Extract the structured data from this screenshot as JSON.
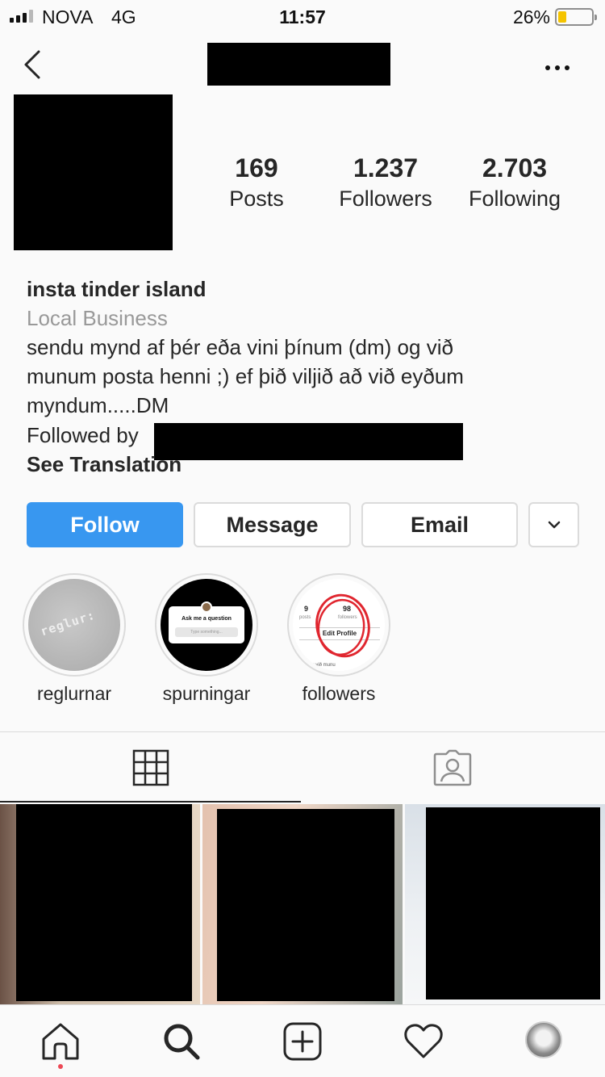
{
  "status_bar": {
    "carrier": "NOVA",
    "network": "4G",
    "time": "11:57",
    "battery_percent": "26%",
    "battery_level": 0.26,
    "signal_bars": 3
  },
  "header": {
    "back_icon": "chevron-left-icon",
    "more_icon": "more-horizontal-icon"
  },
  "stats": [
    {
      "value": "169",
      "label": "Posts"
    },
    {
      "value": "1.237",
      "label": "Followers"
    },
    {
      "value": "2.703",
      "label": "Following"
    }
  ],
  "bio": {
    "name": "insta tinder island",
    "category": "Local Business",
    "line1": "sendu mynd af þér eða vini þínum (dm) og við",
    "line2": "munum posta henni ;) ef þið viljið að við eyðum",
    "line3": "myndum.....DM",
    "followed_by": "Followed by",
    "see_translation": "See Translation"
  },
  "actions": {
    "follow": "Follow",
    "message": "Message",
    "email": "Email",
    "dropdown_icon": "chevron-down-icon",
    "follow_color": "#3897f0"
  },
  "highlights": [
    {
      "label": "reglurnar",
      "cover_text": "reglur:"
    },
    {
      "label": "spurningar",
      "cover_title": "Ask me a question",
      "cover_input": "Type something..."
    },
    {
      "label": "followers",
      "cover_posts_num": "9",
      "cover_posts_label": "posts",
      "cover_followers_num": "98",
      "cover_followers_label": "followers",
      "cover_button": "Edit Profile",
      "cover_footer": "(dm) og við munu"
    }
  ],
  "tabs": {
    "grid_icon": "grid-icon",
    "tagged_icon": "tagged-person-icon"
  },
  "nav": {
    "home_icon": "home-icon",
    "search_icon": "search-icon",
    "add_icon": "add-post-icon",
    "activity_icon": "heart-icon",
    "profile_icon": "profile-avatar"
  }
}
